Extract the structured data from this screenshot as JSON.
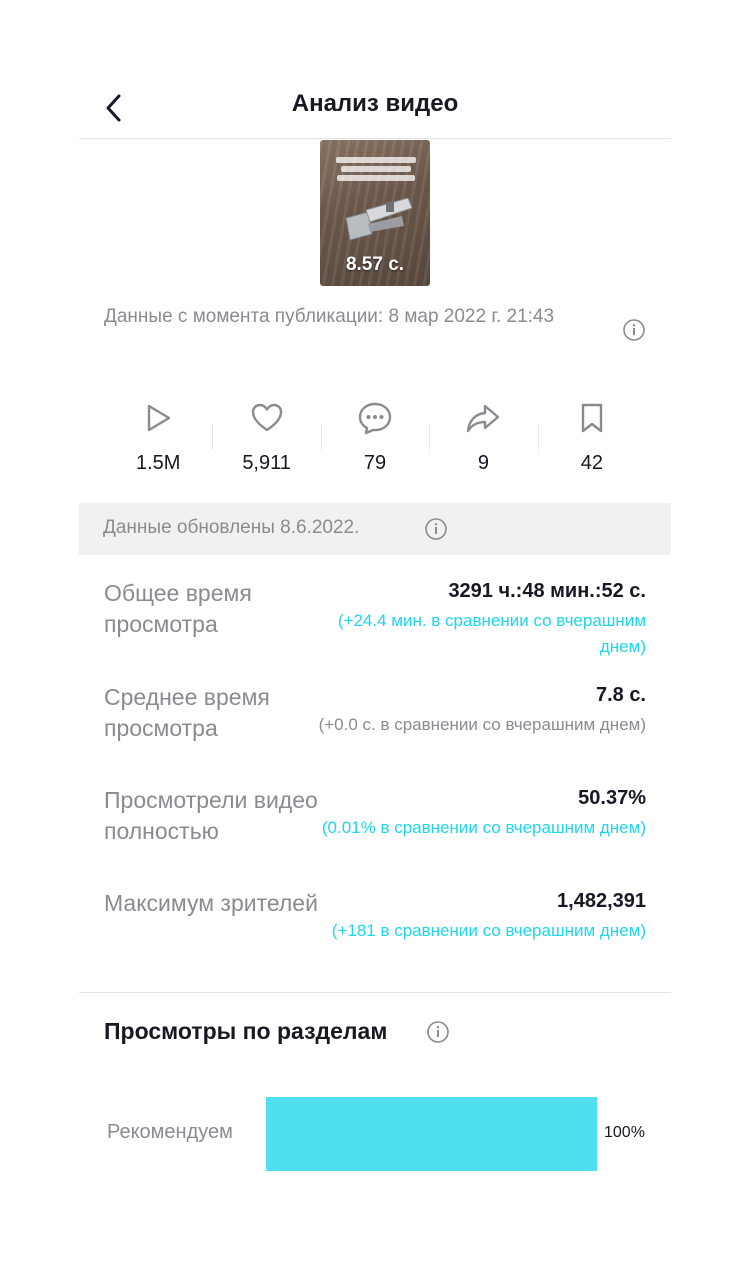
{
  "header": {
    "title": "Анализ видео"
  },
  "video": {
    "duration": "8.57 с."
  },
  "publication": {
    "text": "Данные с момента публикации: 8 мар 2022 г. 21:43"
  },
  "stats": [
    {
      "icon": "play-icon",
      "value": "1.5M"
    },
    {
      "icon": "heart-icon",
      "value": "5,911"
    },
    {
      "icon": "comment-icon",
      "value": "79"
    },
    {
      "icon": "share-icon",
      "value": "9"
    },
    {
      "icon": "bookmark-icon",
      "value": "42"
    }
  ],
  "updated": {
    "text": "Данные обновлены 8.6.2022."
  },
  "metrics": [
    {
      "label": "Общее время просмотра",
      "value": "3291 ч.:48 мин.:52 с.",
      "comparison": "(+24.4 мин. в сравнении со вчерашним днем)",
      "comparison_color": "#20d5ec"
    },
    {
      "label": "Среднее время просмотра",
      "value": "7.8 с.",
      "comparison": "(+0.0 с. в сравнении со вчерашним днем)",
      "comparison_color": "#8a8b91"
    },
    {
      "label": "Просмотрели видео полностью",
      "value": "50.37%",
      "comparison": "(0.01% в сравнении со вчерашним днем)",
      "comparison_color": "#20d5ec"
    },
    {
      "label": "Максимум зрителей",
      "value": "1,482,391",
      "comparison": "(+181 в сравнении со вчерашним днем)",
      "comparison_color": "#20d5ec"
    }
  ],
  "sections": {
    "title": "Просмотры по разделам",
    "items": [
      {
        "label": "Рекомендуем",
        "percent_text": "100%",
        "share": 1.0
      }
    ]
  },
  "colors": {
    "accent": "#20d5ec",
    "bar": "#4fdfef",
    "muted": "#8a8b91",
    "text": "#161823"
  }
}
